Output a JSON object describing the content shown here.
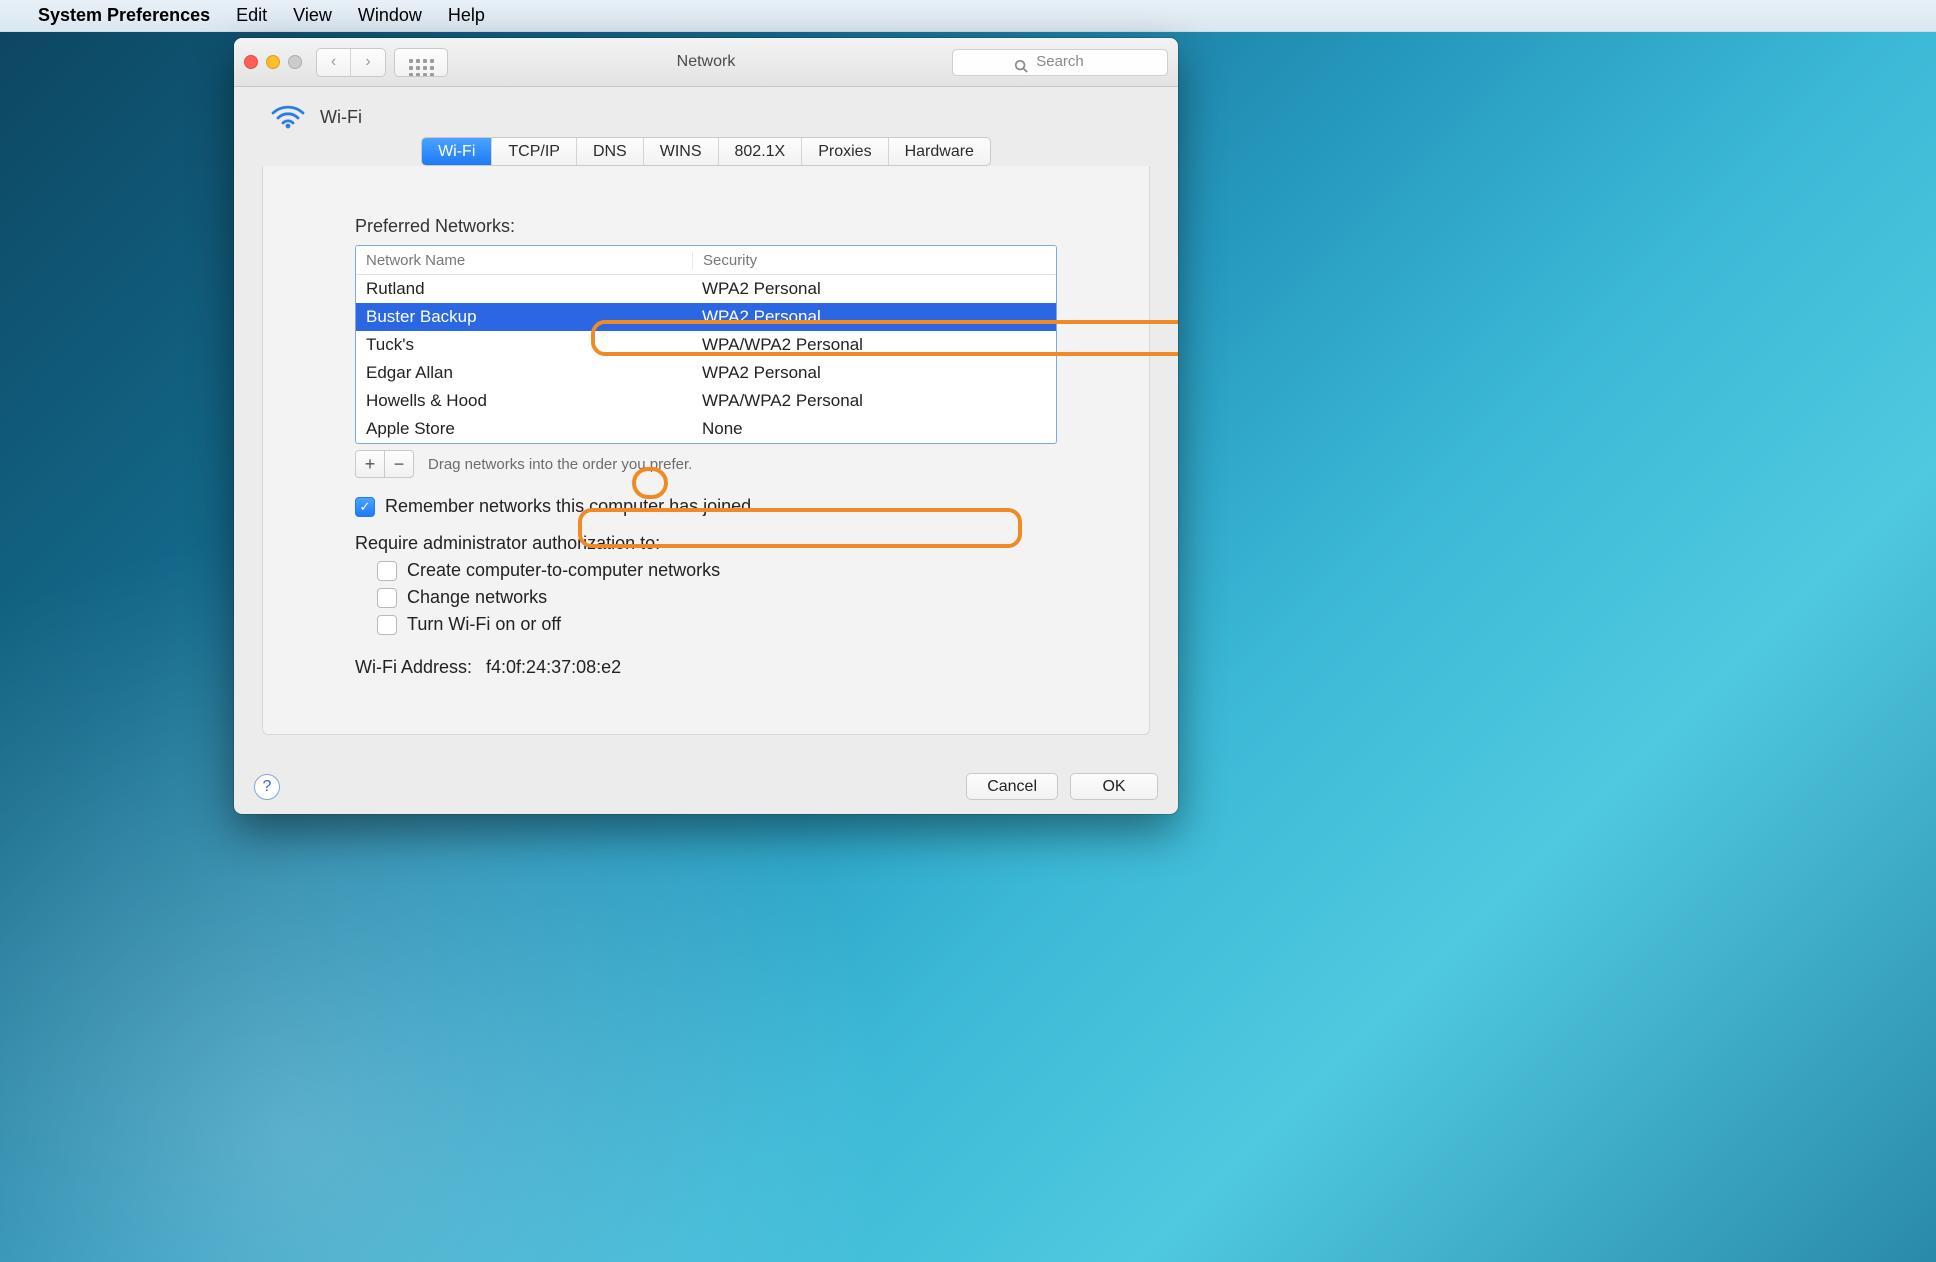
{
  "menubar": {
    "app": "System Preferences",
    "items": [
      "Edit",
      "View",
      "Window",
      "Help"
    ]
  },
  "window": {
    "title": "Network",
    "search_placeholder": "Search"
  },
  "pane": {
    "title": "Wi-Fi"
  },
  "tabs": [
    "Wi-Fi",
    "TCP/IP",
    "DNS",
    "WINS",
    "802.1X",
    "Proxies",
    "Hardware"
  ],
  "active_tab": 0,
  "preferred_label": "Preferred Networks:",
  "columns": [
    "Network Name",
    "Security"
  ],
  "networks": [
    {
      "name": "Rutland",
      "security": "WPA2 Personal"
    },
    {
      "name": "Buster Backup",
      "security": "WPA2 Personal"
    },
    {
      "name": "Tuck's",
      "security": "WPA/WPA2 Personal"
    },
    {
      "name": "Edgar Allan",
      "security": "WPA2 Personal"
    },
    {
      "name": "Howells & Hood",
      "security": "WPA/WPA2 Personal"
    },
    {
      "name": "Apple Store",
      "security": "None"
    }
  ],
  "selected_network": 1,
  "drag_hint": "Drag networks into the order you prefer.",
  "remember_label": "Remember networks this computer has joined",
  "remember_checked": true,
  "require_label": "Require administrator authorization to:",
  "require_options": [
    {
      "label": "Create computer-to-computer networks",
      "checked": false
    },
    {
      "label": "Change networks",
      "checked": false
    },
    {
      "label": "Turn Wi-Fi on or off",
      "checked": false
    }
  ],
  "wifi_addr_label": "Wi-Fi Address:",
  "wifi_addr": "f4:0f:24:37:08:e2",
  "buttons": {
    "cancel": "Cancel",
    "ok": "OK"
  },
  "colors": {
    "accent": "#2b67e3",
    "highlight": "#f08a24"
  }
}
